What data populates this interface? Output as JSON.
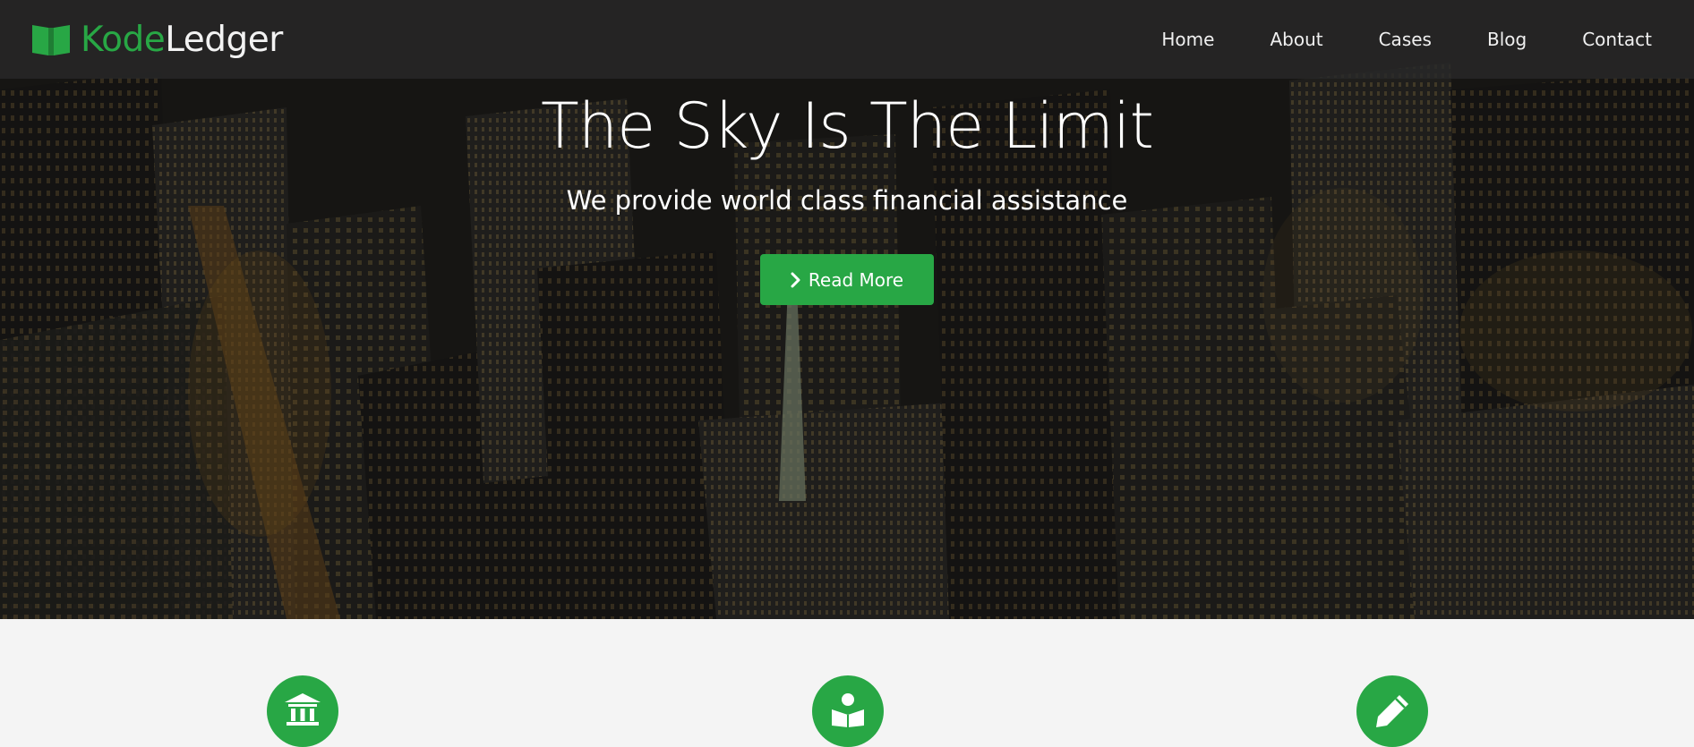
{
  "brand": {
    "prefix": "Kode",
    "suffix": "Ledger",
    "icon": "book-icon",
    "accent_color": "#28a745"
  },
  "nav": {
    "items": [
      {
        "label": "Home"
      },
      {
        "label": "About"
      },
      {
        "label": "Cases"
      },
      {
        "label": "Blog"
      },
      {
        "label": "Contact"
      }
    ]
  },
  "hero": {
    "title": "The Sky Is The Limit",
    "subtitle": "We provide world class financial assistance",
    "button_label": "Read More",
    "button_icon": "chevron-right-icon",
    "button_color": "#28a745"
  },
  "features": {
    "icons": [
      "bank-icon",
      "reader-icon",
      "pencil-icon"
    ],
    "circle_color": "#28a745"
  }
}
